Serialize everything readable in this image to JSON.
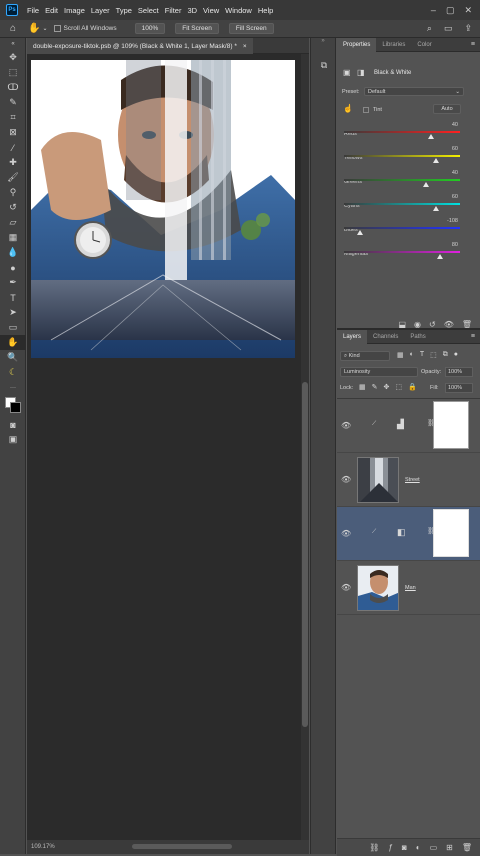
{
  "menu": {
    "app_badge": "Ps",
    "items": [
      "File",
      "Edit",
      "Image",
      "Layer",
      "Type",
      "Select",
      "Filter",
      "3D",
      "View",
      "Window",
      "Help"
    ],
    "window_controls": [
      "–",
      "▢",
      "✕"
    ]
  },
  "options": {
    "scroll_all_windows": "Scroll All Windows",
    "zoom_100": "100%",
    "fit_screen": "Fit Screen",
    "fill_screen": "Fill Screen"
  },
  "document": {
    "tab_title": "double-exposure-tiktok.psb @ 109% (Black & White 1, Layer Mask/8) *",
    "close": "×",
    "zoom_status": "109.17%"
  },
  "properties": {
    "tabs": [
      "Properties",
      "Libraries",
      "Color"
    ],
    "title": "Black & White",
    "preset_label": "Preset:",
    "preset_value": "Default",
    "tint_label": "Tint",
    "auto_label": "Auto",
    "sliders": [
      {
        "label": "Reds",
        "value": "40",
        "level": 0.75,
        "track": "linear-gradient(to right,#3a3a3a,#ff2020)"
      },
      {
        "label": "Yellows",
        "value": "60",
        "level": 0.79,
        "track": "linear-gradient(to right,#3a3a3a,#f5f000)"
      },
      {
        "label": "Greens",
        "value": "40",
        "level": 0.71,
        "track": "linear-gradient(to right,#3a3a3a,#22cc22)"
      },
      {
        "label": "Cyans",
        "value": "60",
        "level": 0.79,
        "track": "linear-gradient(to right,#3a3a3a,#00e0e0)"
      },
      {
        "label": "Blues",
        "value": "-108",
        "level": 0.14,
        "track": "linear-gradient(to right,#3a3a3a,#2233ff)"
      },
      {
        "label": "Magentas",
        "value": "80",
        "level": 0.83,
        "track": "linear-gradient(to right,#3a3a3a,#e020e0)"
      }
    ]
  },
  "layers": {
    "tabs": [
      "Layers",
      "Channels",
      "Paths"
    ],
    "filter_kind": "Kind",
    "blend_mode": "Luminosity",
    "opacity_label": "Opacity:",
    "opacity_value": "100%",
    "lock_label": "Lock:",
    "fill_label": "Fill:",
    "fill_value": "100%",
    "items": [
      {
        "name": "",
        "type": "adjustment-levels",
        "selected": false
      },
      {
        "name": "Street",
        "type": "image-city",
        "selected": false
      },
      {
        "name": "",
        "type": "adjustment-bw",
        "selected": true
      },
      {
        "name": "Man",
        "type": "image-man",
        "selected": false
      }
    ]
  }
}
